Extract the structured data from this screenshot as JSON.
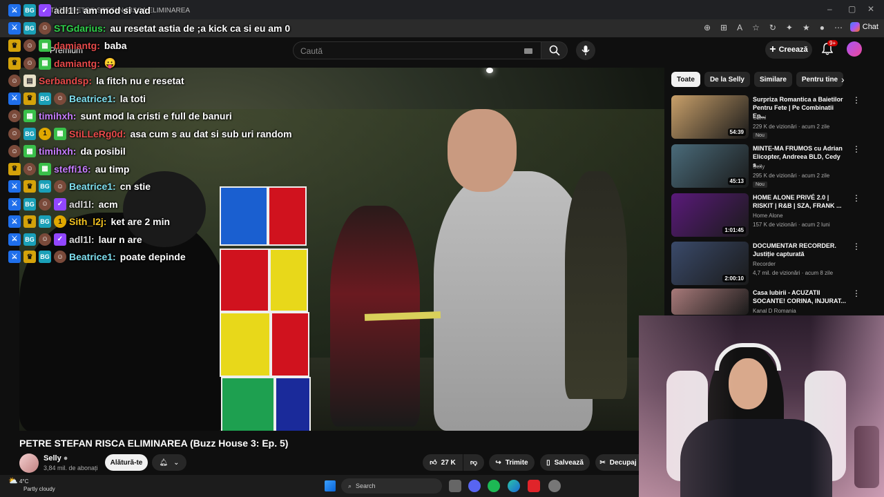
{
  "browser": {
    "tab_title": "ⓢ TikTok PETRE STEFAN RISCA ELIMINAREA",
    "chat_label": "Chat"
  },
  "youtube": {
    "premium_label": "Premium",
    "search_placeholder": "Caută",
    "create_label": "Creează",
    "notif_count": "9+"
  },
  "chat": {
    "messages": [
      {
        "user": "adl1l:",
        "text": "am mod si vad",
        "user_color": "#d9d9d9",
        "badges": [
          "sword",
          "bg",
          "verif"
        ]
      },
      {
        "user": "STGdarius:",
        "text": "au resetat astia de ;a kick ca si eu am 0",
        "user_color": "#2fd14a",
        "badges": [
          "sword",
          "bg",
          "face"
        ]
      },
      {
        "user": "damiantg:",
        "text": "baba",
        "user_color": "#e84a4a",
        "badges": [
          "crown",
          "face",
          "gift"
        ]
      },
      {
        "user": "damiantg:",
        "text": "😛",
        "user_color": "#e84a4a",
        "badges": [
          "crown",
          "face",
          "gift"
        ]
      },
      {
        "user": "Serbandsp:",
        "text": "la fitch nu e resetat",
        "user_color": "#e84a4a",
        "badges": [
          "face",
          "gray"
        ]
      },
      {
        "user": "Beatrice1:",
        "text": "la toti",
        "user_color": "#7fe0f0",
        "badges": [
          "sword",
          "crown",
          "bg",
          "face"
        ]
      },
      {
        "user": "timihxh:",
        "text": "sunt mod la cristi e full de banuri",
        "user_color": "#c77dff",
        "badges": [
          "face",
          "gift"
        ]
      },
      {
        "user": "StiLLeRg0d:",
        "text": "asa cum s au dat si sub uri random",
        "user_color": "#e84a4a",
        "badges": [
          "face",
          "bg",
          "one",
          "gift"
        ]
      },
      {
        "user": "timihxh:",
        "text": "da posibil",
        "user_color": "#c77dff",
        "badges": [
          "face",
          "gift"
        ]
      },
      {
        "user": "steffi16:",
        "text": "au timp",
        "user_color": "#c77dff",
        "badges": [
          "crown",
          "face",
          "gift"
        ]
      },
      {
        "user": "Beatrice1:",
        "text": "cn stie",
        "user_color": "#7fe0f0",
        "badges": [
          "sword",
          "crown",
          "bg",
          "face"
        ]
      },
      {
        "user": "adl1l:",
        "text": "acm",
        "user_color": "#d9d9d9",
        "badges": [
          "sword",
          "bg",
          "face",
          "verif"
        ]
      },
      {
        "user": "Sith_l2j:",
        "text": "ket are 2 min",
        "user_color": "#f0c020",
        "badges": [
          "sword",
          "crown",
          "bg",
          "one"
        ]
      },
      {
        "user": "adl1l:",
        "text": "laur n are",
        "user_color": "#d9d9d9",
        "badges": [
          "sword",
          "bg",
          "face",
          "verif"
        ]
      },
      {
        "user": "Beatrice1:",
        "text": "poate depinde",
        "user_color": "#7fe0f0",
        "badges": [
          "sword",
          "crown",
          "bg",
          "face"
        ]
      }
    ]
  },
  "video": {
    "title": "PETRE STEFAN RISCA ELIMINAREA (Buzz House 3: Ep. 5)",
    "channel": "Selly",
    "subscribers": "3,84 mil. de abonați",
    "join_label": "Alătură-te",
    "likes": "27 K",
    "share_label": "Trimite",
    "save_label": "Salvează",
    "clip_label": "Decupaj"
  },
  "sidebar": {
    "chips": [
      "Toate",
      "De la Selly",
      "Similare",
      "Pentru tine"
    ],
    "recommendations": [
      {
        "title": "Surpriza Romantica a Baietilor Pentru Fete | Pe Combinatii Ep...",
        "channel": "Gami",
        "meta": "229 K de vizionări · acum 2 zile",
        "duration": "54:39",
        "new": "Nou",
        "thumb": "#c9a06a"
      },
      {
        "title": "MINTE-MA FRUMOS cu Adrian Elicopter, Andreea BLD, Cedy s...",
        "channel": "Selly",
        "meta": "295 K de vizionări · acum 2 zile",
        "duration": "45:13",
        "new": "Nou",
        "thumb": "#4a6b7a"
      },
      {
        "title": "HOME ALONE PRIVÉ 2.0 | RISKIT | R&B | SZA, FRANK ...",
        "channel": "Home Alone",
        "meta": "157 K de vizionări · acum 2 luni",
        "duration": "1:01:45",
        "new": "",
        "thumb": "#5a1a7a"
      },
      {
        "title": "DOCUMENTAR RECORDER. Justiție capturată",
        "channel": "Recorder",
        "meta": "4,7 mil. de vizionări · acum 8 zile",
        "duration": "2:00:10",
        "new": "",
        "thumb": "#3a4a6a"
      },
      {
        "title": "Casa Iubirii - ACUZATII SOCANTE! CORINA, INJURAT...",
        "channel": "Kanal D Romania",
        "meta": "",
        "duration": "",
        "new": "",
        "thumb": "#a87a7a"
      }
    ]
  },
  "taskbar": {
    "temperature": "4°C",
    "weather": "Partly cloudy",
    "search_label": "Search"
  }
}
